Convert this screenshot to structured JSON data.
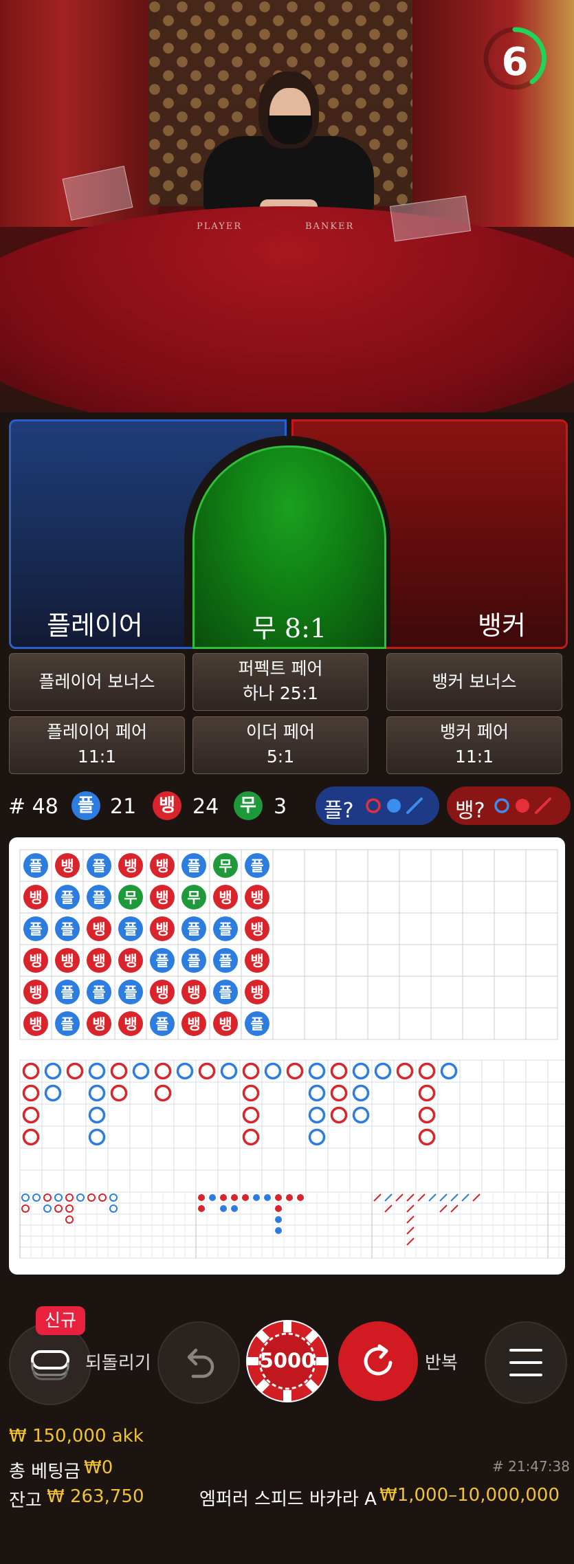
{
  "video": {
    "table_text_player": "PLAYER",
    "table_text_banker": "BANKER",
    "timer": "6"
  },
  "zones": {
    "player": "플레이어",
    "tie": "무 8:1",
    "banker": "뱅커"
  },
  "side_bets": [
    {
      "l1": "플레이어 보너스",
      "l2": ""
    },
    {
      "l1": "퍼펙트 페어",
      "l2": "하나 25:1"
    },
    {
      "l1": "뱅커 보너스",
      "l2": ""
    },
    {
      "l1": "플레이어 페어",
      "l2": "11:1"
    },
    {
      "l1": "이더 페어",
      "l2": "5:1"
    },
    {
      "l1": "뱅커 페어",
      "l2": "11:1"
    }
  ],
  "stats": {
    "round": "# 48",
    "player_glyph": "플",
    "player_count": "21",
    "banker_glyph": "뱅",
    "banker_count": "24",
    "tie_glyph": "무",
    "tie_count": "3",
    "player_predict": "플?",
    "banker_predict": "뱅?"
  },
  "colors": {
    "player": "#2d7de0",
    "banker": "#d9242b",
    "tie": "#1f9a3a",
    "gold": "#f2c230",
    "new_badge": "#e8213e"
  },
  "bead_road": [
    [
      "플",
      "뱅",
      "플",
      "뱅",
      "뱅",
      "플",
      "무",
      "플"
    ],
    [
      "뱅",
      "플",
      "플",
      "무",
      "뱅",
      "무",
      "뱅",
      "뱅"
    ],
    [
      "플",
      "플",
      "뱅",
      "플",
      "뱅",
      "플",
      "플",
      "뱅"
    ],
    [
      "뱅",
      "뱅",
      "뱅",
      "뱅",
      "플",
      "플",
      "플",
      "뱅"
    ],
    [
      "뱅",
      "플",
      "플",
      "플",
      "뱅",
      "뱅",
      "플",
      "뱅"
    ],
    [
      "뱅",
      "플",
      "뱅",
      "뱅",
      "플",
      "뱅",
      "뱅",
      "플"
    ]
  ],
  "big_road": [
    {
      "c": "b",
      "cells": 4
    },
    {
      "c": "p",
      "cells": 2
    },
    {
      "c": "b",
      "cells": 1
    },
    {
      "c": "p",
      "cells": 4
    },
    {
      "c": "b",
      "cells": 2
    },
    {
      "c": "p",
      "cells": 1
    },
    {
      "c": "b",
      "cells": 2
    },
    {
      "c": "p",
      "cells": 1
    },
    {
      "c": "b",
      "cells": 1
    },
    {
      "c": "p",
      "cells": 1
    },
    {
      "c": "b",
      "cells": 4
    },
    {
      "c": "p",
      "cells": 1
    },
    {
      "c": "b",
      "cells": 1
    },
    {
      "c": "p",
      "cells": 4
    },
    {
      "c": "b",
      "cells": 3
    },
    {
      "c": "p",
      "cells": 3
    },
    {
      "c": "p",
      "cells": 1
    },
    {
      "c": "b",
      "cells": 1
    },
    {
      "c": "b",
      "cells": 4
    },
    {
      "c": "p",
      "cells": 1
    }
  ],
  "controls": {
    "new_badge": "신규",
    "undo_label": "되돌리기",
    "chip_value": "5000",
    "repeat_label": "반복"
  },
  "footer": {
    "bet_line": "₩ 150,000 akk",
    "total_bet_label": "총 베팅금",
    "total_bet_value": "₩0",
    "balance_label": "잔고",
    "balance_value": "₩ 263,750",
    "round_id": "# 21:47:38",
    "table_name": "엠퍼러 스피드 바카라 A",
    "limits": "₩1,000–10,000,000"
  }
}
